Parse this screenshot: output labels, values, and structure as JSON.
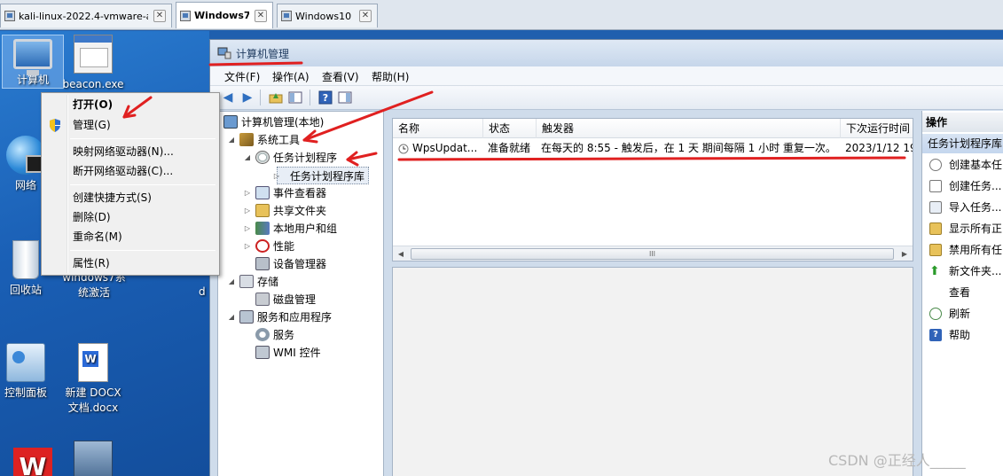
{
  "vm_tabs": [
    {
      "label": "kali-linux-2022.4-vmware-am...",
      "active": false
    },
    {
      "label": "Windows7",
      "active": true
    },
    {
      "label": "Windows10",
      "active": false
    }
  ],
  "desktop": {
    "icons": [
      {
        "label": "计算机",
        "icon": "computer-icon"
      },
      {
        "label": "beacon.exe",
        "icon": "exe-file-icon"
      },
      {
        "label": "网络",
        "icon": "network-icon"
      },
      {
        "label": "回收站",
        "icon": "recycle-bin-icon"
      },
      {
        "label": "windows7系统激活",
        "icon": "activator-icon"
      },
      {
        "label": "控制面板",
        "icon": "control-panel-icon"
      },
      {
        "label": "新建 DOCX 文档.docx",
        "icon": "docx-file-icon"
      },
      {
        "label": "",
        "icon": "wps-icon"
      },
      {
        "label": "",
        "icon": "setup-icon"
      }
    ],
    "partial_label": "d"
  },
  "context_menu": {
    "items": [
      "打开(O)",
      "管理(G)",
      "映射网络驱动器(N)...",
      "断开网络驱动器(C)...",
      "创建快捷方式(S)",
      "删除(D)",
      "重命名(M)",
      "属性(R)"
    ]
  },
  "window": {
    "title": "计算机管理",
    "menu": [
      "文件(F)",
      "操作(A)",
      "查看(V)",
      "帮助(H)"
    ]
  },
  "tree": {
    "root": "计算机管理(本地)",
    "system_tools": "系统工具",
    "task_scheduler": "任务计划程序",
    "task_library": "任务计划程序库",
    "event_viewer": "事件查看器",
    "shared_folders": "共享文件夹",
    "local_users": "本地用户和组",
    "performance": "性能",
    "device_manager": "设备管理器",
    "storage": "存储",
    "disk_management": "磁盘管理",
    "services_apps": "服务和应用程序",
    "services": "服务",
    "wmi": "WMI 控件"
  },
  "task_list": {
    "columns": [
      "名称",
      "状态",
      "触发器",
      "下次运行时间"
    ],
    "rows": [
      {
        "name": "WpsUpdat...",
        "status": "准备就绪",
        "trigger": "在每天的 8:55 - 触发后，在 1 天 期间每隔 1 小时 重复一次。",
        "next_run": "2023/1/12 19"
      }
    ],
    "scroll_thumb": "III"
  },
  "actions": {
    "header": "操作",
    "section": "任务计划程序库",
    "items": [
      "创建基本任",
      "创建任务...",
      "导入任务...",
      "显示所有正",
      "禁用所有任",
      "新文件夹...",
      "查看",
      "刷新",
      "帮助"
    ]
  },
  "watermark": "CSDN @正经人_____",
  "colors": {
    "annotation_red": "#e02020",
    "selection_blue": "#c4d6ee"
  }
}
